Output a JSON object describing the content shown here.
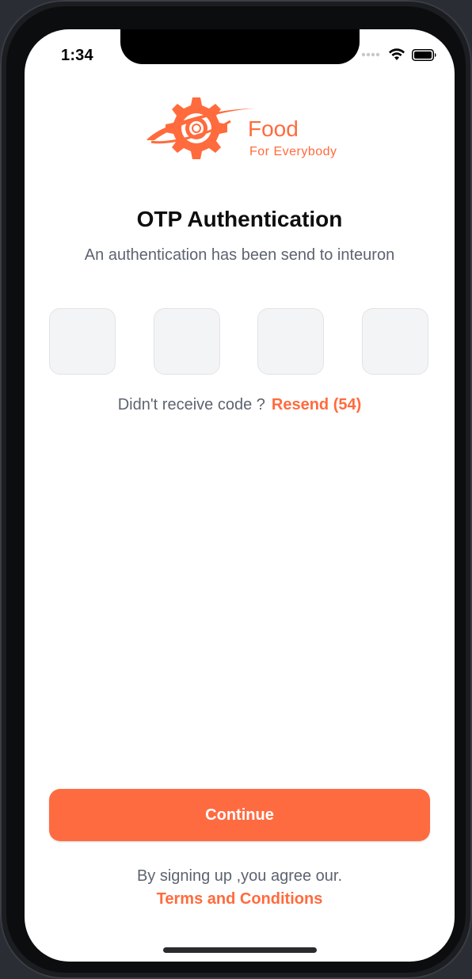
{
  "status_bar": {
    "time": "1:34"
  },
  "logo": {
    "word": "Food",
    "tagline": "For Everybody",
    "color": "#ff6b3d"
  },
  "header": {
    "title": "OTP Authentication",
    "subtitle": "An authentication has been send to inteuron"
  },
  "otp": {
    "digits": [
      "",
      "",
      "",
      ""
    ]
  },
  "resend": {
    "prompt": "Didn't receive code ?",
    "link": "Resend (54)"
  },
  "actions": {
    "continue_label": "Continue"
  },
  "footer": {
    "agree_text": "By signing up ,you agree our.",
    "terms_link": "Terms and Conditions"
  },
  "colors": {
    "accent": "#ff6b41",
    "text_primary": "#0e0e0e",
    "text_secondary": "#5d6370",
    "otp_box_bg": "#f3f4f6"
  }
}
